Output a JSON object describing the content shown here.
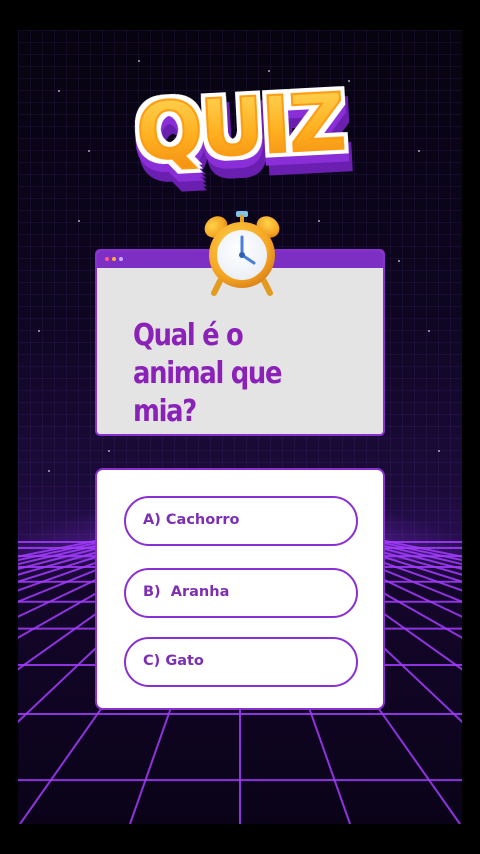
{
  "logo": {
    "text": "QUIZ"
  },
  "question": {
    "text": "Qual é o animal que mia?"
  },
  "answers": [
    {
      "label": "A) Cachorro"
    },
    {
      "label": "B)  Aranha"
    },
    {
      "label": "C) Gato"
    }
  ],
  "icons": {
    "timer": "alarm-clock-icon"
  },
  "colors": {
    "accent_purple": "#8a2fd0",
    "title_purple": "#8b22b8",
    "logo_orange": "#ffb21a",
    "question_bg": "#e4e4e4",
    "background": "#0d0620"
  }
}
